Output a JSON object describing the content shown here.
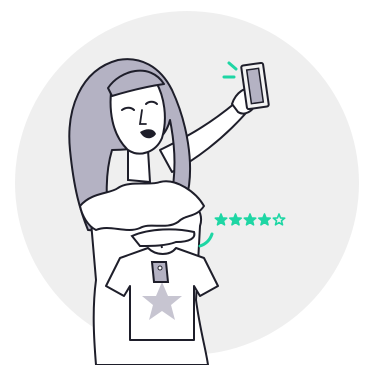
{
  "illustration": {
    "subject": "woman-taking-selfie-with-tshirt",
    "rating": {
      "value": 4,
      "max": 5
    },
    "colors": {
      "background_circle": "#efefef",
      "hair": "#b4b2c3",
      "outline": "#1e1e2a",
      "accent": "#1ed6a4",
      "skin": "#ffffff",
      "star_on_shirt": "#c7c5d1"
    },
    "icons": [
      "phone-icon",
      "star-icon",
      "price-tag-icon",
      "tshirt-icon"
    ]
  }
}
